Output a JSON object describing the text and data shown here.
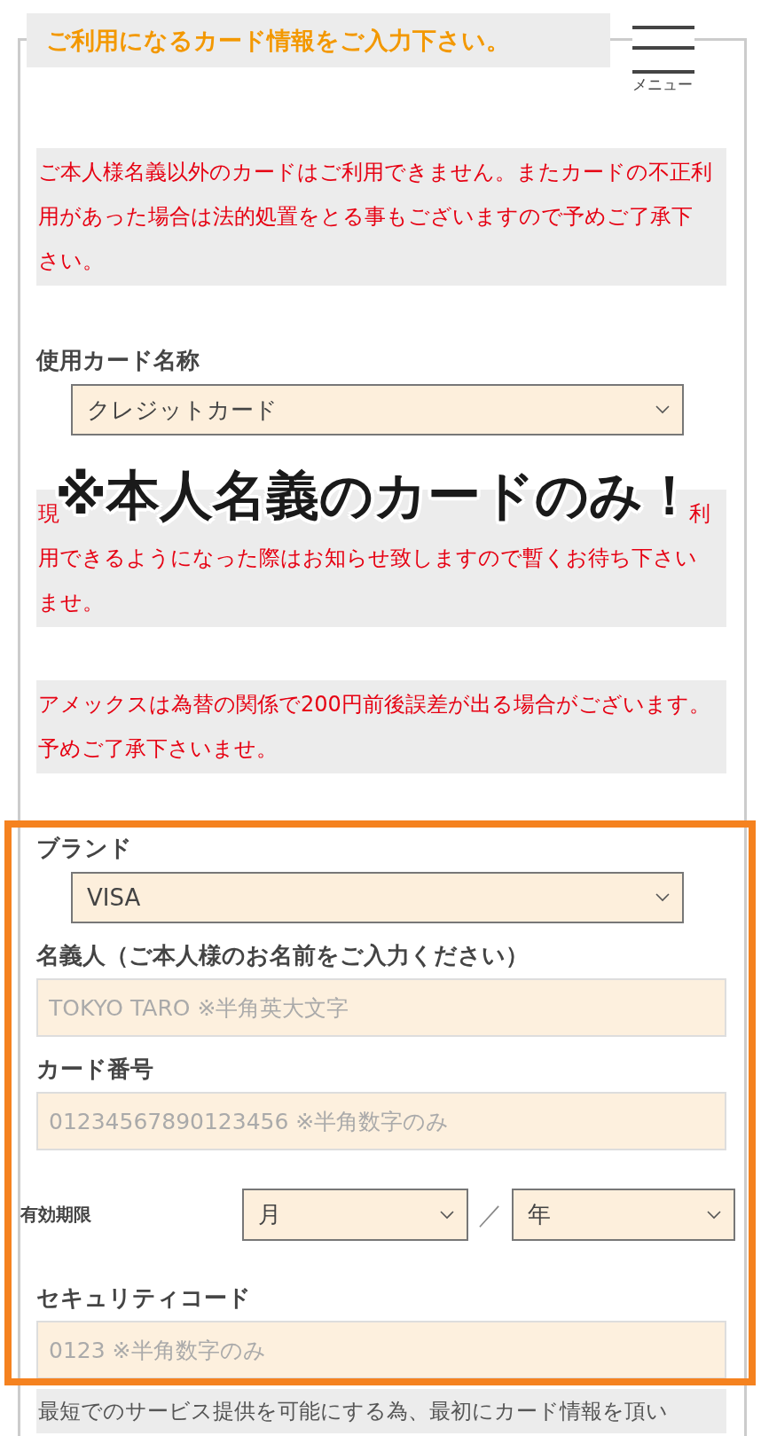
{
  "header": {
    "title": "ご利用になるカード情報をご入力下さい。",
    "menu_label": "メニュー"
  },
  "items": [
    {
      "kind": "notice",
      "text": "ご本人様名義以外のカードはご利用できません。またカードの不正利用があった場合は法的処置をとる事もございますので予めご了承下さい。"
    },
    {
      "kind": "select",
      "label": "使用カード名称",
      "value": "クレジットカード"
    },
    {
      "kind": "covered_notice",
      "visible_start": "現",
      "visible_end": "利",
      "text": "用できるようになった際はお知らせ致しますので暫くお待ち下さいませ。"
    },
    {
      "kind": "notice",
      "text": "アメックスは為替の関係で200円前後誤差が出る場合がございます。予めご了承下さいませ。"
    },
    {
      "kind": "select",
      "label": "ブランド",
      "value": "VISA"
    },
    {
      "kind": "input",
      "label": "名義人（ご本人様のお名前をご入力ください）",
      "placeholder": "TOKYO TARO ※半角英大文字"
    },
    {
      "kind": "input",
      "label": "カード番号",
      "placeholder": "01234567890123456 ※半角数字のみ"
    },
    {
      "kind": "expiry",
      "label": "有効期限",
      "month": "月",
      "separator": "／",
      "year": "年"
    },
    {
      "kind": "input",
      "label": "セキュリティコード",
      "placeholder": "0123 ※半角数字のみ"
    },
    {
      "kind": "info",
      "text": "最短でのサービス提供を可能にする為、最初にカード情報を頂い"
    }
  ],
  "annotation": {
    "text": "※本人名義のカードのみ！"
  }
}
